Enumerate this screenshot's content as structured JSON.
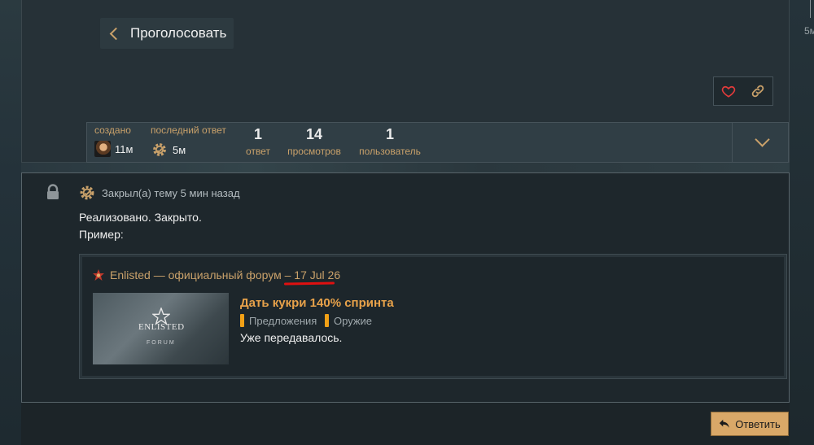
{
  "vote_button": {
    "label": "Проголосовать"
  },
  "topic_meta": {
    "created": {
      "label": "создано",
      "time": "11м"
    },
    "last_reply": {
      "label": "последний ответ",
      "time": "5м"
    },
    "stats": [
      {
        "value": "1",
        "label": "ответ"
      },
      {
        "value": "14",
        "label": "просмотров"
      },
      {
        "value": "1",
        "label": "пользователь"
      }
    ]
  },
  "timeline": {
    "label": "5м"
  },
  "closed_notice": {
    "action_text": "Закрыл(а) тему 5 мин назад",
    "lines": [
      "Реализовано. Закрыто.",
      "Пример:"
    ]
  },
  "onebox": {
    "source_name": "Enlisted — официальный форум",
    "separator": " – ",
    "date": "17 Jul 26",
    "thumbnail_text": "ENLISTED",
    "thumbnail_subtext": "FORUM",
    "title": "Дать кукри 140% спринта",
    "categories": [
      "Предложения",
      "Оружие"
    ],
    "excerpt": "Уже передавалось."
  },
  "reply_button": {
    "label": "Ответить"
  },
  "colors": {
    "accent": "#c9a16a",
    "category": "#f1a016",
    "underline": "#e01010"
  }
}
